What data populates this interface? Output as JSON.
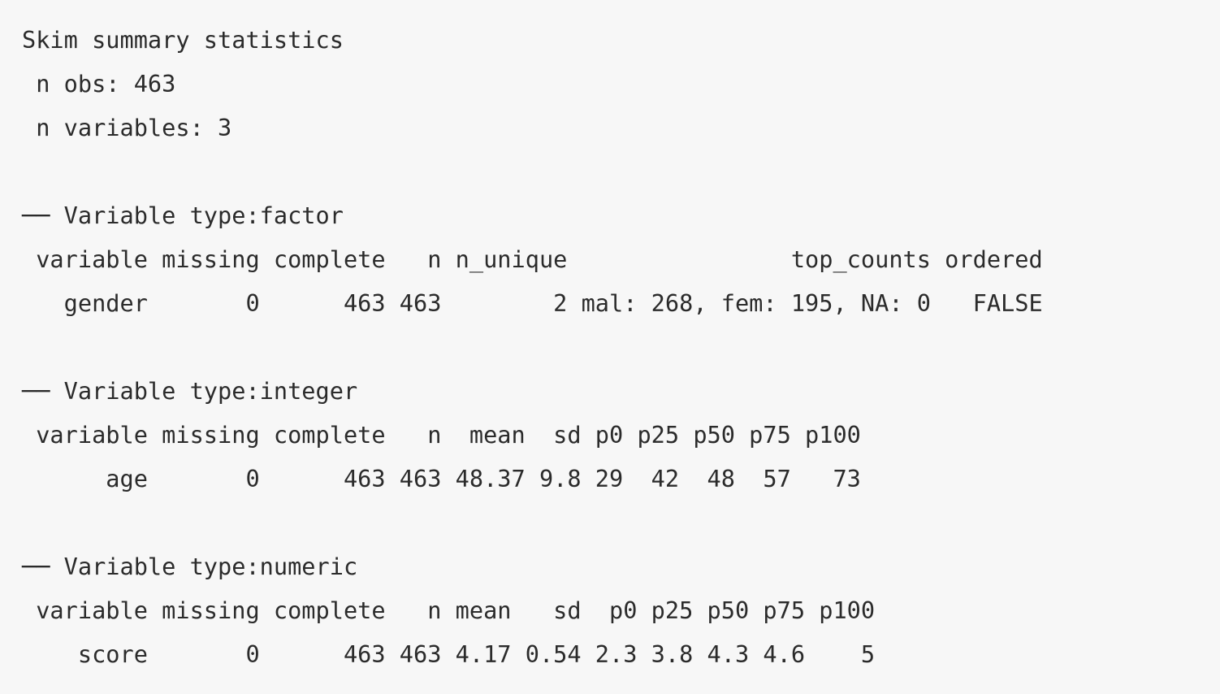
{
  "output": {
    "title": "Skim summary statistics",
    "n_obs": " n obs: 463",
    "n_vars": " n variables: 3",
    "blank": "",
    "factor": {
      "header": "── Variable type:factor",
      "columns": " variable missing complete   n n_unique                top_counts ordered",
      "row": "   gender       0      463 463        2 mal: 268, fem: 195, NA: 0   FALSE"
    },
    "integer": {
      "header": "── Variable type:integer",
      "columns": " variable missing complete   n  mean  sd p0 p25 p50 p75 p100",
      "row": "      age       0      463 463 48.37 9.8 29  42  48  57   73"
    },
    "numeric": {
      "header": "── Variable type:numeric",
      "columns": " variable missing complete   n mean   sd  p0 p25 p50 p75 p100",
      "row": "    score       0      463 463 4.17 0.54 2.3 3.8 4.3 4.6    5"
    }
  }
}
